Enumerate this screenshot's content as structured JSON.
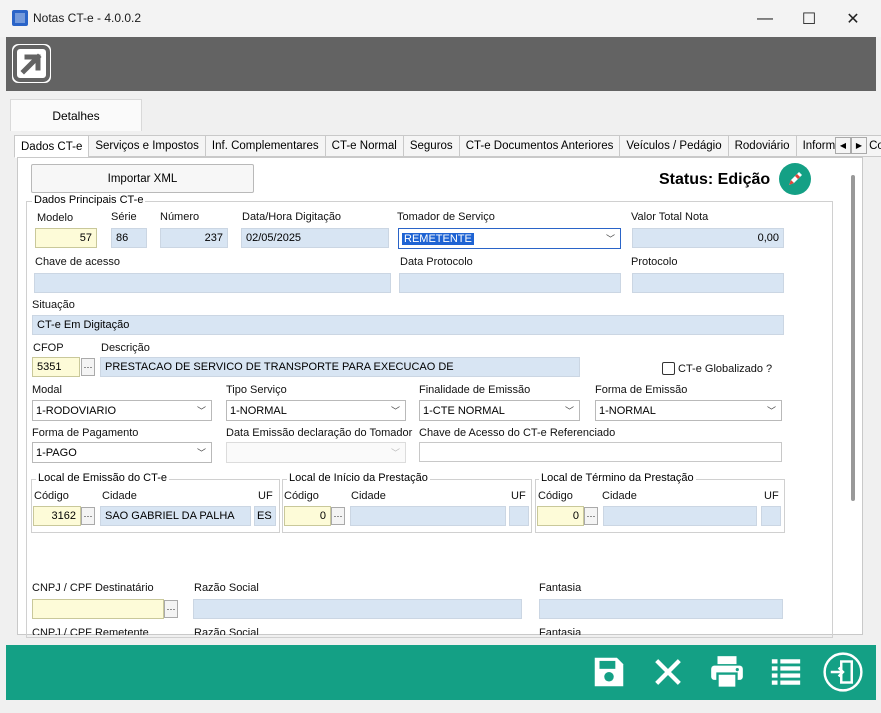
{
  "window": {
    "title": "Notas CT-e - 4.0.0.2",
    "minimize": "—",
    "maximize": "☐",
    "close": "✕"
  },
  "main_tab": "Detalhes",
  "subtabs": [
    "Dados CT-e",
    "Serviços e Impostos",
    "Inf. Complementares",
    "CT-e Normal",
    "Seguros",
    "CT-e Documentos Anteriores",
    "Veículos / Pedágio",
    "Rodoviário",
    "Informações Contr"
  ],
  "import_button": "Importar XML",
  "status": "Status: Edição",
  "principal": {
    "group_title": "Dados Principais CT-e",
    "modelo_label": "Modelo",
    "modelo": "57",
    "serie_label": "Série",
    "serie": "86",
    "numero_label": "Número",
    "numero": "237",
    "data_hora_label": "Data/Hora Digitação",
    "data_hora": "02/05/2025",
    "tomador_label": "Tomador de Serviço",
    "tomador": "REMETENTE",
    "valor_total_label": "Valor Total Nota",
    "valor_total": "0,00",
    "chave_label": "Chave de acesso",
    "chave": "",
    "data_protocolo_label": "Data Protocolo",
    "data_protocolo": "",
    "protocolo_label": "Protocolo",
    "protocolo": "",
    "situacao_label": "Situação",
    "situacao": "CT-e Em Digitação",
    "cfop_label": "CFOP",
    "cfop": "5351",
    "descricao_label": "Descrição",
    "descricao": "PRESTACAO DE SERVICO DE TRANSPORTE PARA EXECUCAO DE",
    "globalizado_label": "CT-e Globalizado ?",
    "modal_label": "Modal",
    "modal": "1-RODOVIARIO",
    "tipo_servico_label": "Tipo Serviço",
    "tipo_servico": "1-NORMAL",
    "finalidade_label": "Finalidade de Emissão",
    "finalidade": "1-CTE NORMAL",
    "forma_emissao_label": "Forma de Emissão",
    "forma_emissao": "1-NORMAL",
    "forma_pagamento_label": "Forma de Pagamento",
    "forma_pagamento": "1-PAGO",
    "data_emissao_tomador_label": "Data Emissão declaração do Tomador",
    "chave_referenciado_label": "Chave de Acesso do CT-e Referenciado"
  },
  "local_emissao": {
    "title": "Local de Emissão do CT-e",
    "codigo_label": "Código",
    "codigo": "3162",
    "cidade_label": "Cidade",
    "cidade": "SAO GABRIEL DA PALHA",
    "uf_label": "UF",
    "uf": "ES"
  },
  "local_inicio": {
    "title": "Local de Início da Prestação",
    "codigo_label": "Código",
    "codigo": "0",
    "cidade_label": "Cidade",
    "cidade": "",
    "uf_label": "UF",
    "uf": ""
  },
  "local_termino": {
    "title": "Local de Término da Prestação",
    "codigo_label": "Código",
    "codigo": "0",
    "cidade_label": "Cidade",
    "cidade": "",
    "uf_label": "UF",
    "uf": ""
  },
  "destinatario": {
    "cnpj_label": "CNPJ / CPF Destinatário",
    "razao_label": "Razão Social",
    "fantasia_label": "Fantasia"
  },
  "remetente": {
    "cnpj_label": "CNPJ / CPF Remetente",
    "razao_label": "Razão Social",
    "fantasia_label": "Fantasia"
  },
  "toolbar_icons": [
    "save-icon",
    "cancel-icon",
    "print-icon",
    "list-icon",
    "exit-icon"
  ],
  "colors": {
    "accent": "#14a085",
    "header": "#636363",
    "field": "#d8e5f3",
    "required": "#fdfbd8"
  }
}
